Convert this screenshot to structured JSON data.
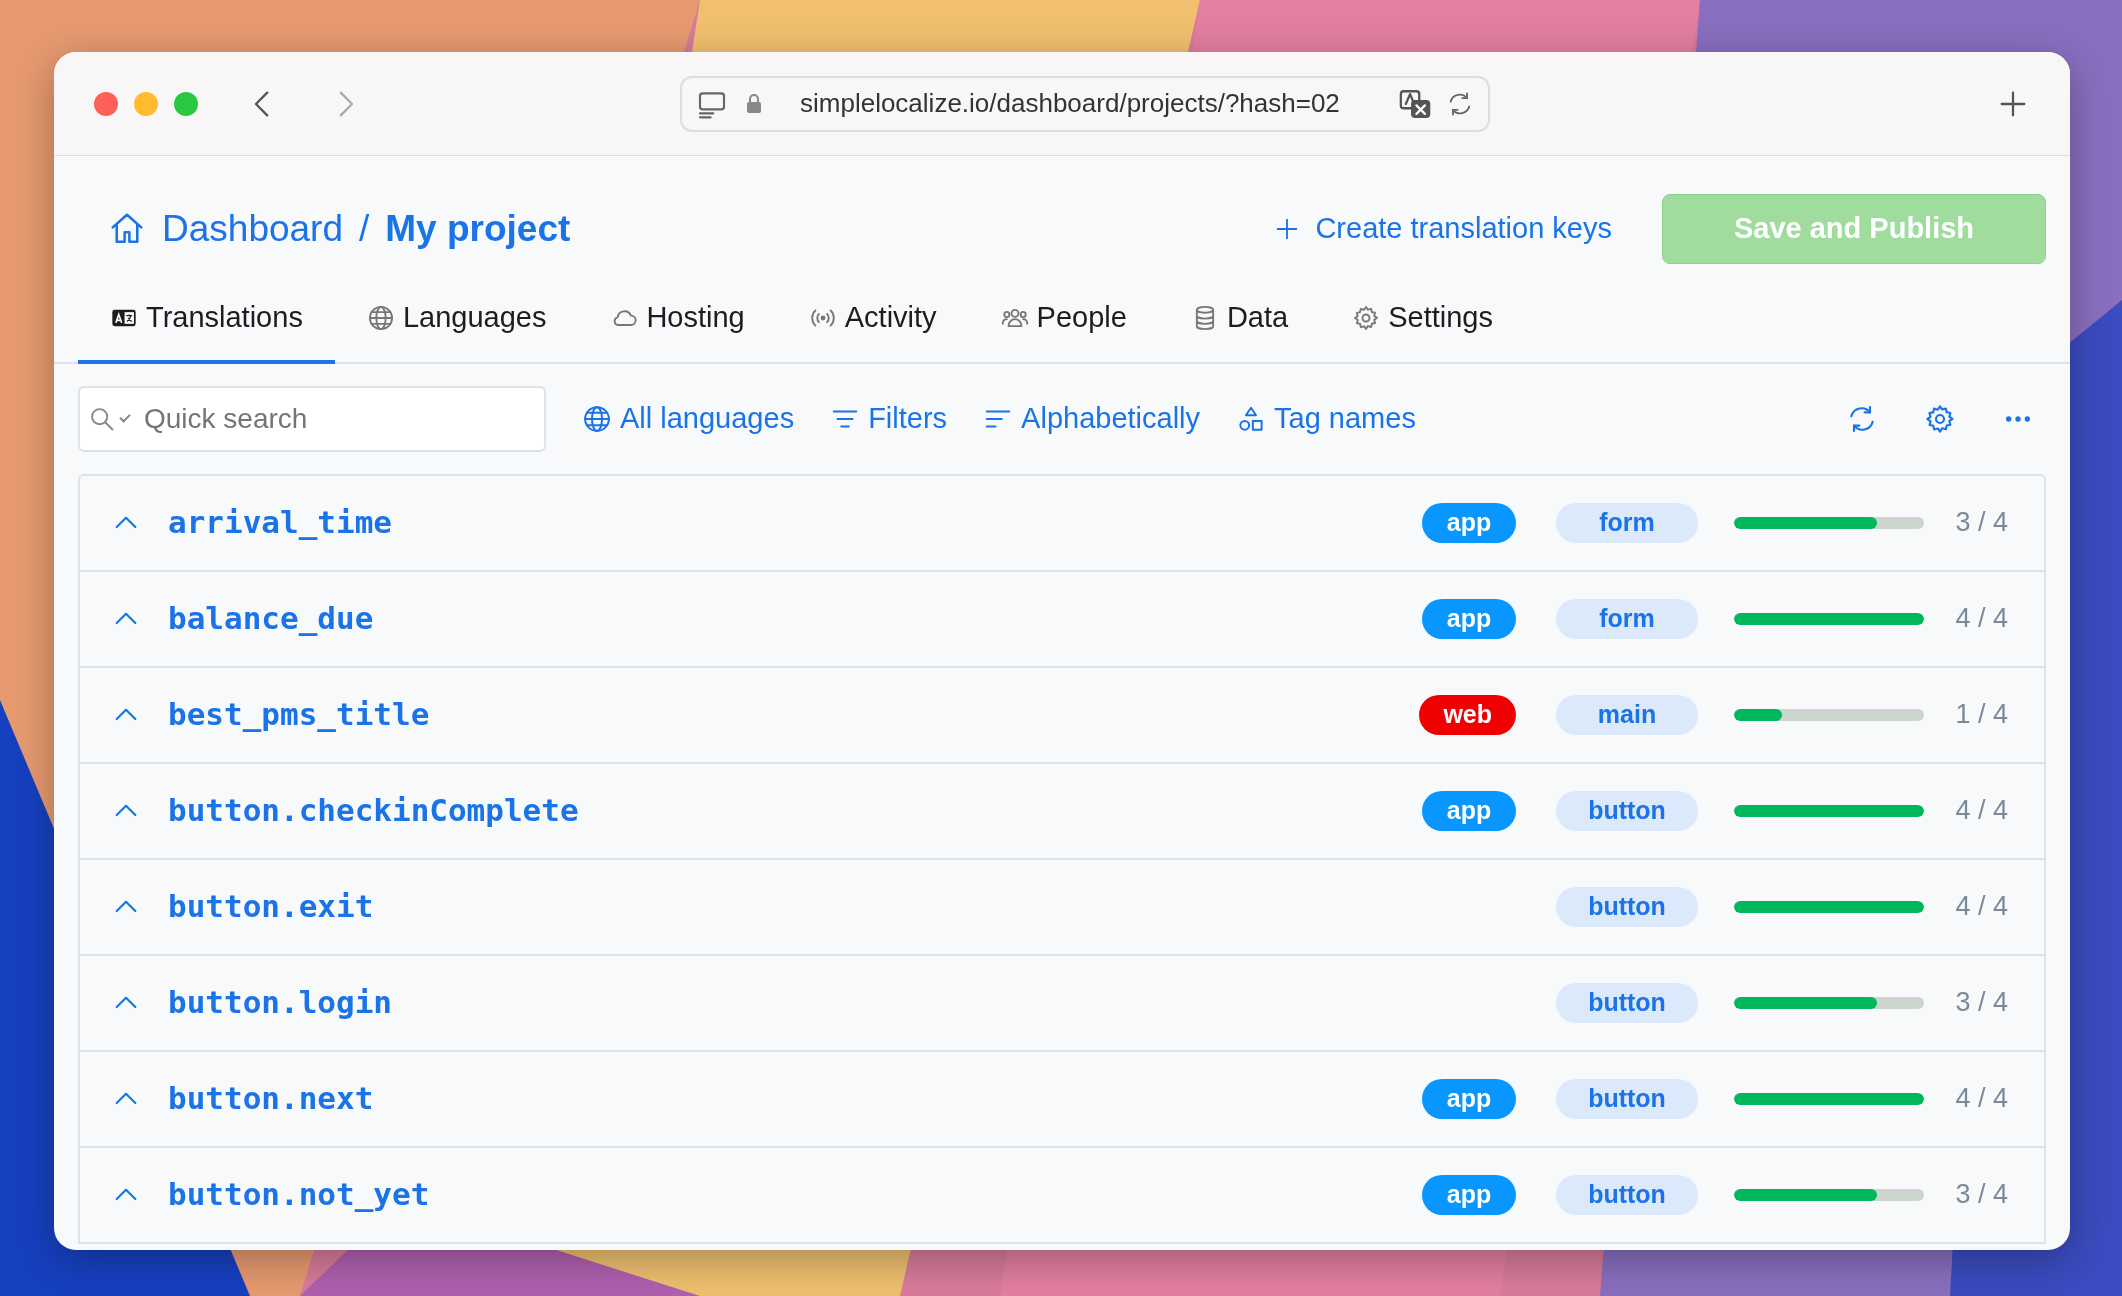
{
  "browser": {
    "url": "simplelocalize.io/dashboard/projects/?hash=02"
  },
  "breadcrumb": {
    "root": "Dashboard",
    "separator": "/",
    "current": "My project"
  },
  "create_keys": "Create translation keys",
  "save_button": {
    "label": "Save and Publish",
    "disabled": true
  },
  "tabs": [
    {
      "label": "Translations",
      "selected": true
    },
    {
      "label": "Languages",
      "selected": false
    },
    {
      "label": "Hosting",
      "selected": false
    },
    {
      "label": "Activity",
      "selected": false
    },
    {
      "label": "People",
      "selected": false
    },
    {
      "label": "Data",
      "selected": false
    },
    {
      "label": "Settings",
      "selected": false
    }
  ],
  "search": {
    "placeholder": "Quick search"
  },
  "toolbar": [
    {
      "label": "All languages"
    },
    {
      "label": "Filters"
    },
    {
      "label": "Alphabetically"
    },
    {
      "label": "Tag names"
    }
  ],
  "keys": [
    {
      "name": "arrival_time",
      "tags": [
        {
          "label": "app",
          "color": "#0a96ff"
        },
        {
          "label": "form"
        }
      ],
      "level": 0.75,
      "count": "3 / 4"
    },
    {
      "name": "balance_due",
      "tags": [
        {
          "label": "app",
          "color": "#0a96ff"
        },
        {
          "label": "form"
        }
      ],
      "level": 1,
      "count": "4 / 4"
    },
    {
      "name": "best_pms_title",
      "tags": [
        {
          "label": "web",
          "color": "#f00000"
        },
        {
          "label": "main"
        }
      ],
      "level": 0.25,
      "count": "1 / 4"
    },
    {
      "name": "button.checkinComplete",
      "tags": [
        {
          "label": "app",
          "color": "#0a96ff"
        },
        {
          "label": "button"
        }
      ],
      "level": 1,
      "count": "4 / 4"
    },
    {
      "name": "button.exit",
      "tags": [
        {
          "label": "button"
        }
      ],
      "level": 1,
      "count": "4 / 4"
    },
    {
      "name": "button.login",
      "tags": [
        {
          "label": "button"
        }
      ],
      "level": 0.75,
      "count": "3 / 4"
    },
    {
      "name": "button.next",
      "tags": [
        {
          "label": "app",
          "color": "#0a96ff"
        },
        {
          "label": "button"
        }
      ],
      "level": 1,
      "count": "4 / 4"
    },
    {
      "name": "button.not_yet",
      "tags": [
        {
          "label": "app",
          "color": "#0a96ff"
        },
        {
          "label": "button"
        }
      ],
      "level": 0.75,
      "count": "3 / 4"
    }
  ]
}
